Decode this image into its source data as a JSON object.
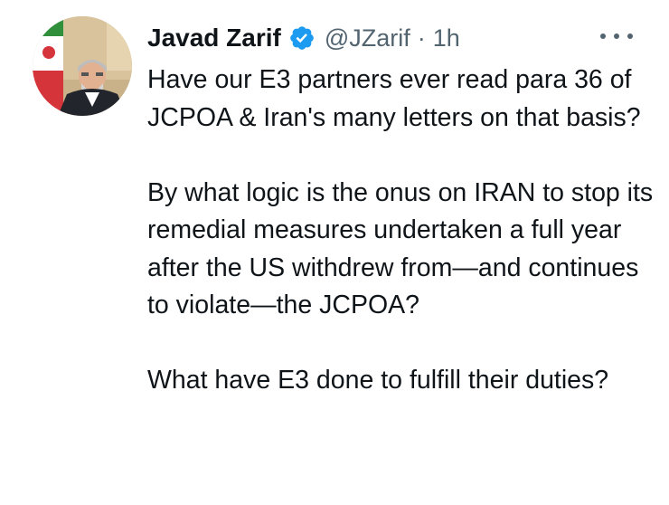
{
  "tweet": {
    "author": {
      "display_name": "Javad Zarif",
      "handle": "@JZarif",
      "verified": true
    },
    "separator": "·",
    "time": "1h",
    "more_icon": "more-horizontal-icon",
    "paragraphs": [
      "Have our E3 partners ever read para 36 of JCPOA & Iran's many letters on that basis?",
      "By what logic is the onus on IRAN to stop its remedial measures undertaken a full year after the US withdrew from—and continues to violate—the JCPOA?",
      "What have E3 done to fulfill their duties?"
    ]
  },
  "colors": {
    "text_primary": "#0f1419",
    "text_secondary": "#536471",
    "verified_badge": "#1d9bf0"
  }
}
